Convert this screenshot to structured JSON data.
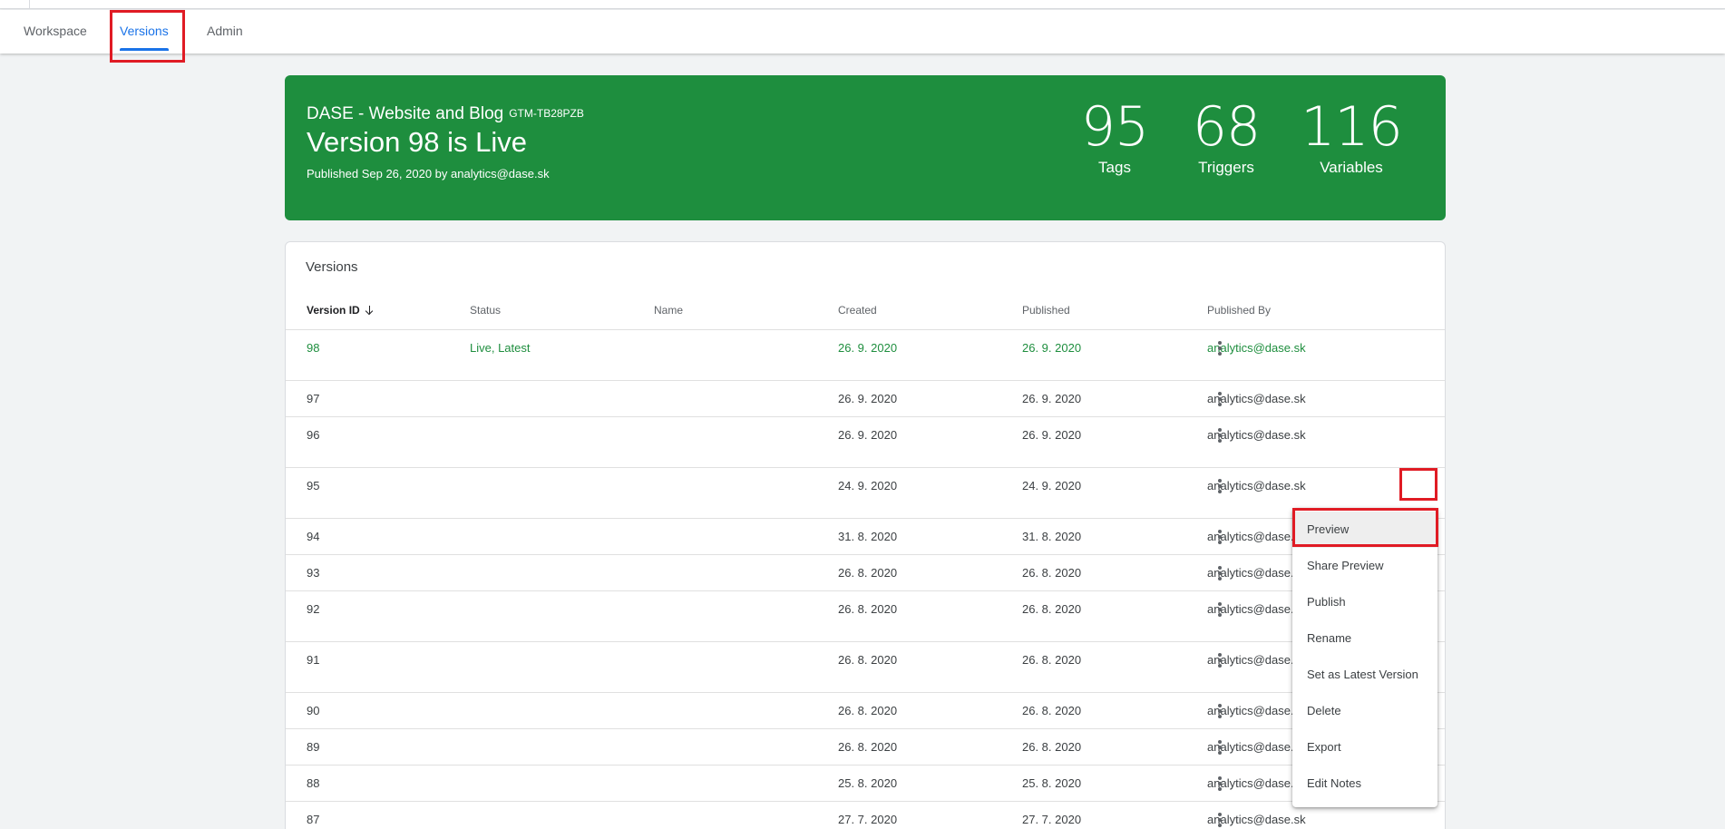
{
  "tabs": [
    {
      "label": "Workspace"
    },
    {
      "label": "Versions"
    },
    {
      "label": "Admin"
    }
  ],
  "hero": {
    "container_name": "DASE - Website and Blog",
    "container_id": "GTM-TB28PZB",
    "live_text": "Version 98 is Live",
    "published_info": "Published Sep 26, 2020 by analytics@dase.sk",
    "stats": [
      {
        "value": "95",
        "label": "Tags"
      },
      {
        "value": "68",
        "label": "Triggers"
      },
      {
        "value": "116",
        "label": "Variables"
      }
    ],
    "color": "#1e8e3e"
  },
  "versions": {
    "title": "Versions",
    "columns": [
      "Version ID",
      "Status",
      "Name",
      "Created",
      "Published",
      "Published By"
    ],
    "rows": [
      {
        "id": "98",
        "status": "Live, Latest",
        "name": "",
        "created": "26. 9. 2020",
        "published": "26. 9. 2020",
        "by": "analytics@dase.sk"
      },
      {
        "id": "97",
        "status": "",
        "name": "",
        "created": "26. 9. 2020",
        "published": "26. 9. 2020",
        "by": "analytics@dase.sk"
      },
      {
        "id": "96",
        "status": "",
        "name": "",
        "created": "26. 9. 2020",
        "published": "26. 9. 2020",
        "by": "analytics@dase.sk"
      },
      {
        "id": "95",
        "status": "",
        "name": "",
        "created": "24. 9. 2020",
        "published": "24. 9. 2020",
        "by": "analytics@dase.sk"
      },
      {
        "id": "94",
        "status": "",
        "name": "",
        "created": "31. 8. 2020",
        "published": "31. 8. 2020",
        "by": "analytics@dase.sk"
      },
      {
        "id": "93",
        "status": "",
        "name": "",
        "created": "26. 8. 2020",
        "published": "26. 8. 2020",
        "by": "analytics@dase.sk"
      },
      {
        "id": "92",
        "status": "",
        "name": "",
        "created": "26. 8. 2020",
        "published": "26. 8. 2020",
        "by": "analytics@dase.sk"
      },
      {
        "id": "91",
        "status": "",
        "name": "",
        "created": "26. 8. 2020",
        "published": "26. 8. 2020",
        "by": "analytics@dase.sk"
      },
      {
        "id": "90",
        "status": "",
        "name": "",
        "created": "26. 8. 2020",
        "published": "26. 8. 2020",
        "by": "analytics@dase.sk"
      },
      {
        "id": "89",
        "status": "",
        "name": "",
        "created": "26. 8. 2020",
        "published": "26. 8. 2020",
        "by": "analytics@dase.sk"
      },
      {
        "id": "88",
        "status": "",
        "name": "",
        "created": "25. 8. 2020",
        "published": "25. 8. 2020",
        "by": "analytics@dase.sk"
      },
      {
        "id": "87",
        "status": "",
        "name": "",
        "created": "27. 7. 2020",
        "published": "27. 7. 2020",
        "by": "analytics@dase.sk"
      }
    ]
  },
  "menu": {
    "items": [
      "Preview",
      "Share Preview",
      "Publish",
      "Rename",
      "Set as Latest Version",
      "Delete",
      "Export",
      "Edit Notes"
    ]
  },
  "icons": {
    "sort": "arrow-down-icon",
    "row_actions": "more-vert-icon"
  },
  "colors": {
    "accent": "#1a73e8",
    "live_green": "#1e8e3e",
    "highlight_red": "#e01b24"
  }
}
